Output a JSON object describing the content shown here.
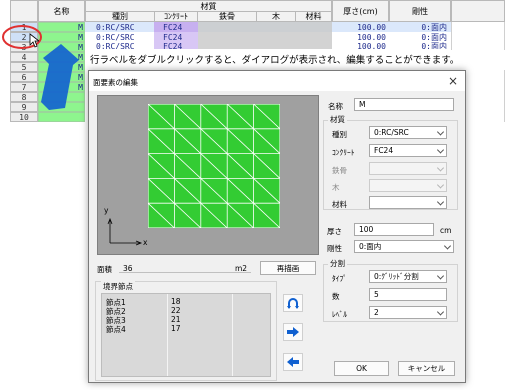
{
  "grid": {
    "headers": {
      "name": "名称",
      "material": "材質",
      "kind": "種別",
      "concrete": "ｺﾝｸﾘｰﾄ",
      "steel": "鉄骨",
      "wood": "木",
      "material2": "材料",
      "thickness": "厚さ(cm)",
      "rigidity": "剛性"
    },
    "row_labels": [
      "1",
      "2",
      "3",
      "4",
      "5",
      "6",
      "7",
      "8",
      "9",
      "10"
    ],
    "rows": [
      {
        "name": "M",
        "kind": "0:RC/SRC",
        "concrete": "FC24",
        "thickness": "100.00",
        "rigidity": "0:面内"
      },
      {
        "name": "M",
        "kind": "0:RC/SRC",
        "concrete": "FC24",
        "thickness": "100.00",
        "rigidity": "0:面内"
      },
      {
        "name": "M",
        "kind": "0:RC/SRC",
        "concrete": "FC24",
        "thickness": "100.00",
        "rigidity": "0:面内"
      }
    ],
    "name_cells": [
      "M",
      "M",
      "M",
      "M",
      "M",
      "M",
      "M"
    ]
  },
  "annotation": "行ラベルをダブルクリックすると、ダイアログが表示され、編集することができます。",
  "dialog": {
    "title": "面要素の編集",
    "close_glyph": "×",
    "axis_y": "y",
    "axis_x": "x",
    "area_label": "面積",
    "area_value": "36",
    "area_unit": "m2",
    "redraw_button": "再描画",
    "boundary_label": "境界節点",
    "boundary_rows": [
      {
        "label": "節点1",
        "value": "18"
      },
      {
        "label": "節点2",
        "value": "22"
      },
      {
        "label": "節点3",
        "value": "21"
      },
      {
        "label": "節点4",
        "value": "17"
      }
    ],
    "name_label": "名称",
    "name_value": "M",
    "material_group": "材質",
    "kind_label": "種別",
    "kind_value": "0:RC/SRC",
    "concrete_label": "ｺﾝｸﾘｰﾄ",
    "concrete_value": "FC24",
    "steel_label": "鉄骨",
    "wood_label": "木",
    "mat_label": "材料",
    "thickness_label": "厚さ",
    "thickness_value": "100",
    "thickness_unit": "cm",
    "rigidity_label": "剛性",
    "rigidity_value": "0:面内",
    "division_group": "分割",
    "type_label": "ﾀｲﾌﾟ",
    "type_value": "0:ｸﾞﾘｯﾄﾞ分割",
    "count_label": "数",
    "count_value": "5",
    "level_label": "ﾚﾍﾞﾙ",
    "level_value": "2",
    "ok_button": "OK",
    "cancel_button": "キャンセル"
  },
  "colors": {
    "mesh_green": "#33cc33",
    "name_green": "#8ef58e",
    "canvas_bg": "#a0a0a0",
    "concrete_purple": "#c7b0f0",
    "value_blue": "#1e2a8c",
    "highlight_circle": "#e03030",
    "arrow_blue": "#1060d0"
  }
}
